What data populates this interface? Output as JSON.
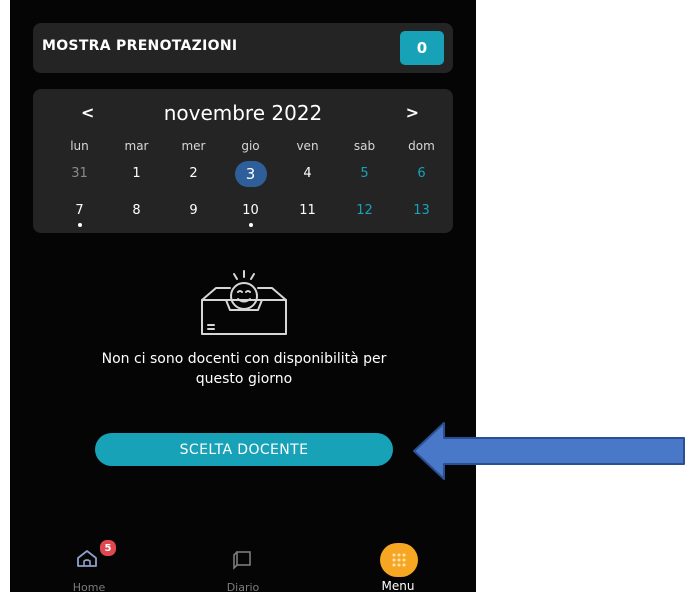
{
  "bookings": {
    "label": "MOSTRA PRENOTAZIONI",
    "count": "0"
  },
  "calendar": {
    "month_label": "novembre 2022",
    "prev": "<",
    "next": ">",
    "weekdays": [
      "lun",
      "mar",
      "mer",
      "gio",
      "ven",
      "sab",
      "dom"
    ],
    "week1": [
      "31",
      "1",
      "2",
      "3",
      "4",
      "5",
      "6"
    ],
    "week2": [
      "7",
      "8",
      "9",
      "10",
      "11",
      "12",
      "13"
    ]
  },
  "empty_state": {
    "icon": "smiling-inbox-icon",
    "message_line1": "Non ci sono docenti con disponibilità per",
    "message_line2": "questo giorno"
  },
  "choose_button": {
    "label": "SCELTA DOCENTE"
  },
  "bottom_nav": {
    "home_label": "Home",
    "home_badge": "5",
    "diario_label": "Diario",
    "menu_label": "Menu"
  },
  "annotation": {
    "arrow_color": "#4a78c8",
    "icon": "left-arrow-icon"
  },
  "colors": {
    "accent": "#18a2b8",
    "selected": "#2f5f9a",
    "menu": "#f6a623",
    "badge": "#e0474f"
  }
}
